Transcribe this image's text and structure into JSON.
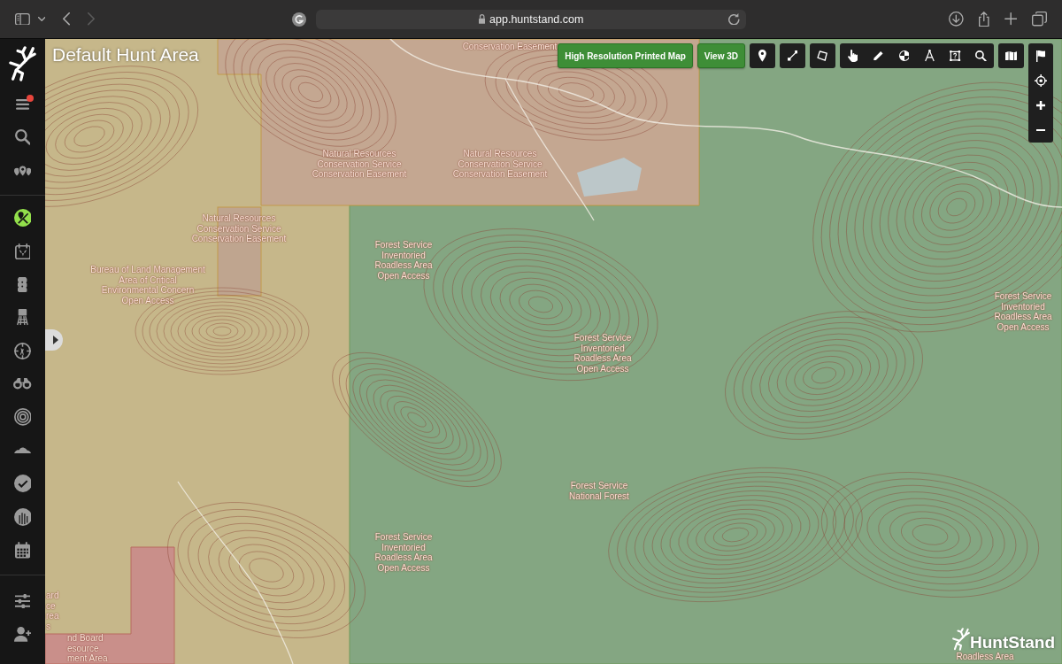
{
  "browser": {
    "nav": [
      {
        "kind": "back",
        "disabled": false
      },
      {
        "kind": "forward",
        "disabled": true
      }
    ],
    "address": "app.huntstand.com"
  },
  "sidebar": {
    "top": [
      {
        "kind": "menu",
        "selected": false,
        "notification": true
      },
      {
        "kind": "search",
        "selected": false,
        "notification": false
      },
      {
        "kind": "places",
        "selected": false,
        "notification": false
      }
    ],
    "tools": [
      {
        "kind": "map-marker",
        "selected": true
      },
      {
        "kind": "calendar-deer",
        "selected": false
      },
      {
        "kind": "backpack",
        "selected": false
      },
      {
        "kind": "stand",
        "selected": false
      },
      {
        "kind": "scope",
        "selected": false
      },
      {
        "kind": "binoculars",
        "selected": false
      },
      {
        "kind": "target",
        "selected": false
      },
      {
        "kind": "terrain",
        "selected": false
      },
      {
        "kind": "check",
        "selected": false
      },
      {
        "kind": "bars",
        "selected": false
      },
      {
        "kind": "calendar",
        "selected": false
      }
    ],
    "bottom": [
      {
        "kind": "sliders",
        "selected": false
      },
      {
        "kind": "add-user",
        "selected": false
      }
    ]
  },
  "map": {
    "title": "Default Hunt Area",
    "labels": [
      "Conservation Easement",
      "Natural Resources\nConservation Service\nConservation Easement",
      "Natural Resources\nConservation Service\nConservation Easement",
      "Natural Resources\nConservation Service\nConservation Easement",
      "Forest Service\nInventoried\nRoadless Area\nOpen Access",
      "Bureau of Land Management\nArea of Critical\nEnvironmental Concern\nOpen Access",
      "Forest Service\nInventoried\nRoadless Area\nOpen Access",
      "Forest Service\nInventoried\nRoadless Area\nOpen Access",
      "Forest Service\nNational Forest",
      "Forest Service\nInventoried\nRoadless Area\nOpen Access",
      "ard\nce\nrea\ns",
      "nd Board\nesource\nment Area",
      "Roadless Area"
    ],
    "brand": "HuntStand"
  },
  "toolbar": {
    "buttons": [
      "High Resolution Printed Map",
      "View 3D"
    ],
    "tool_groups": [
      [
        {
          "kind": "pin",
          "selected": false
        }
      ],
      [
        {
          "kind": "line",
          "selected": false
        }
      ],
      [
        {
          "kind": "polygon",
          "selected": false
        }
      ],
      [
        {
          "kind": "hand",
          "selected": false
        },
        {
          "kind": "pencil",
          "selected": false
        },
        {
          "kind": "quartered",
          "selected": false
        },
        {
          "kind": "compass",
          "selected": false
        },
        {
          "kind": "area-query",
          "selected": false
        },
        {
          "kind": "search",
          "selected": false
        }
      ],
      [
        {
          "kind": "map",
          "selected": false
        }
      ]
    ]
  },
  "map_controls": [
    {
      "kind": "flag"
    },
    {
      "kind": "locate"
    },
    {
      "kind": "zoom-in"
    },
    {
      "kind": "zoom-out"
    }
  ]
}
